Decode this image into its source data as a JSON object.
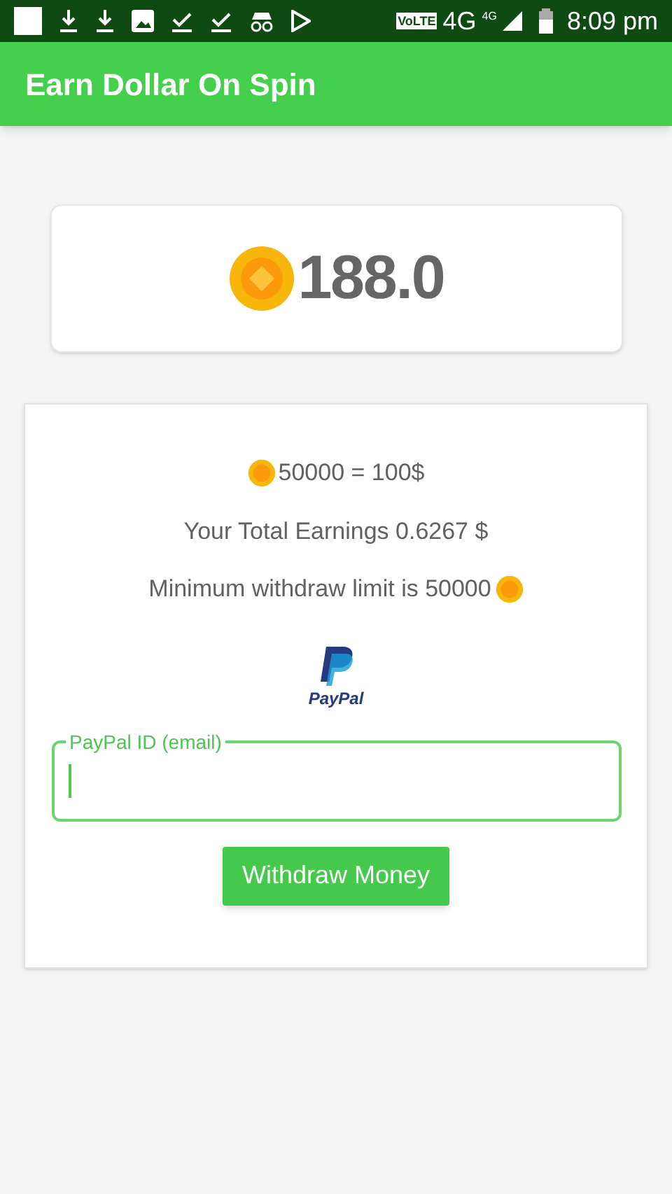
{
  "status_bar": {
    "volte": "VoLTE",
    "network": "4G",
    "network_small": "4G",
    "time": "8:09 pm"
  },
  "app_bar": {
    "title": "Earn Dollar On Spin"
  },
  "balance": {
    "value": "188.0"
  },
  "withdraw_card": {
    "rate": "50000 = 100$",
    "earnings": "Your Total Earnings 0.6267 $",
    "minimum": "Minimum withdraw limit is 50000",
    "logo_text": "PayPal",
    "field": {
      "label": "PayPal ID (email)",
      "focused": true
    },
    "button": "Withdraw Money"
  }
}
